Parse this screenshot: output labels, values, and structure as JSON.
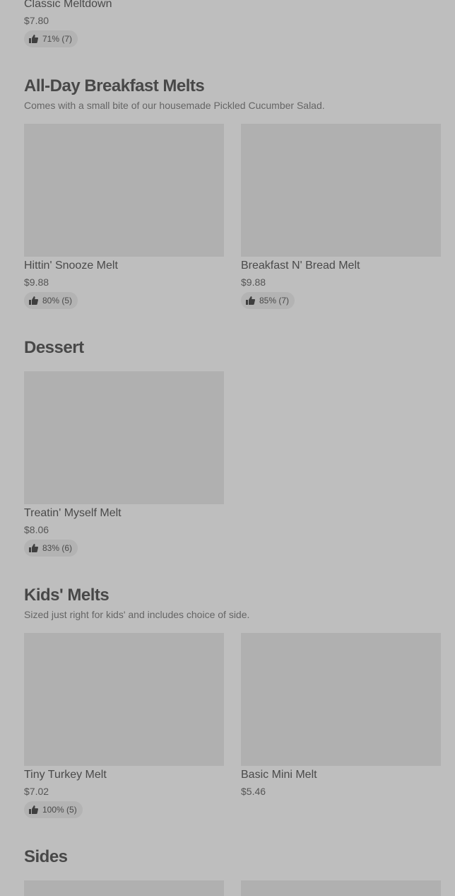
{
  "top_item": {
    "name": "Classic Meltdown",
    "price": "$7.80",
    "rating": "71% (7)"
  },
  "sections": {
    "breakfast": {
      "title": "All-Day Breakfast Melts",
      "subtitle": "Comes with a small bite of our housemade Pickled Cucumber Salad.",
      "items": [
        {
          "name": "Hittin' Snooze Melt",
          "price": "$9.88",
          "rating": "80% (5)"
        },
        {
          "name": "Breakfast N' Bread Melt",
          "price": "$9.88",
          "rating": "85% (7)"
        }
      ]
    },
    "dessert": {
      "title": "Dessert",
      "items": [
        {
          "name": "Treatin' Myself Melt",
          "price": "$8.06",
          "rating": "83% (6)"
        }
      ]
    },
    "kids": {
      "title": "Kids' Melts",
      "subtitle": "Sized just right for kids' and includes choice of side.",
      "items": [
        {
          "name": "Tiny Turkey Melt",
          "price": "$7.02",
          "rating": "100% (5)"
        },
        {
          "name": "Basic Mini Melt",
          "price": "$5.46"
        }
      ]
    },
    "sides": {
      "title": "Sides"
    }
  },
  "icons": {
    "rating": "thumbs-up-icon"
  },
  "colors": {
    "background": "#bebebe",
    "image_placeholder": "#b0b0b0",
    "rating_pill": "#b3b3b3"
  }
}
